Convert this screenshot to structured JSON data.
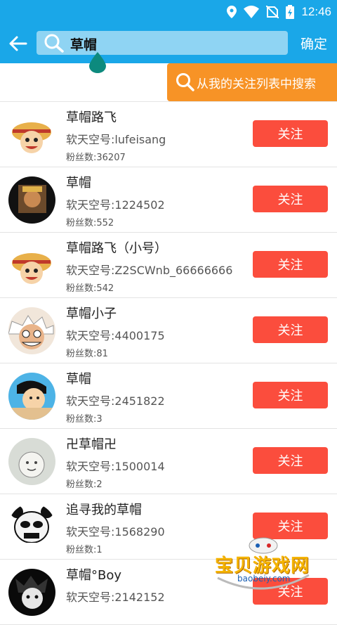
{
  "status_bar": {
    "time": "12:46",
    "icons": [
      "location-icon",
      "wifi-icon",
      "no-sim-icon",
      "battery-icon"
    ]
  },
  "toolbar": {
    "search_text": "草帽",
    "confirm_label": "确定"
  },
  "follow_search_label": "从我的关注列表中搜索",
  "colors": {
    "primary": "#1aa7e8",
    "orange": "#f79326",
    "follow": "#fb4d3d"
  },
  "results": [
    {
      "name": "草帽路飞",
      "uid": "软天空号:lufeisang",
      "fans": "粉丝数:36207",
      "button": "关注",
      "avatar": "luffy"
    },
    {
      "name": "草帽",
      "uid": "软天空号:1224502",
      "fans": "粉丝数:552",
      "button": "关注",
      "avatar": "dark"
    },
    {
      "name": "草帽路飞（小号）",
      "uid": "软天空号:Z2SCWnb_66666666",
      "fans": "粉丝数:542",
      "button": "关注",
      "avatar": "luffy"
    },
    {
      "name": "草帽小子",
      "uid": "软天空号:4400175",
      "fans": "粉丝数:81",
      "button": "关注",
      "avatar": "face"
    },
    {
      "name": "草帽",
      "uid": "软天空号:2451822",
      "fans": "粉丝数:3",
      "button": "关注",
      "avatar": "blue"
    },
    {
      "name": "卍草帽卍",
      "uid": "软天空号:1500014",
      "fans": "粉丝数:2",
      "button": "关注",
      "avatar": "gray"
    },
    {
      "name": "追寻我的草帽",
      "uid": "软天空号:1568290",
      "fans": "粉丝数:1",
      "button": "关注",
      "avatar": "panda"
    },
    {
      "name": "草帽°Boy",
      "uid": "软天空号:2142152",
      "fans": "",
      "button": "关注",
      "avatar": "black"
    }
  ],
  "watermark": {
    "title": "宝贝游戏网",
    "url": "baobeiy.com"
  }
}
